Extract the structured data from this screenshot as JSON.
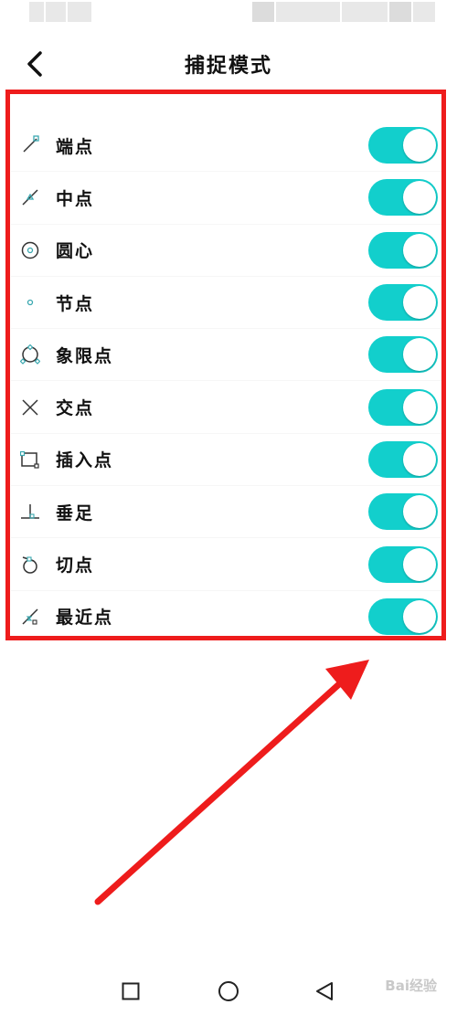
{
  "header": {
    "title": "捕捉模式"
  },
  "snap_items": [
    {
      "label": "端点",
      "icon": "endpoint-icon",
      "enabled": true
    },
    {
      "label": "中点",
      "icon": "midpoint-icon",
      "enabled": true
    },
    {
      "label": "圆心",
      "icon": "center-icon",
      "enabled": true
    },
    {
      "label": "节点",
      "icon": "node-icon",
      "enabled": true
    },
    {
      "label": "象限点",
      "icon": "quadrant-icon",
      "enabled": true
    },
    {
      "label": "交点",
      "icon": "intersection-icon",
      "enabled": true
    },
    {
      "label": "插入点",
      "icon": "insertion-icon",
      "enabled": true
    },
    {
      "label": "垂足",
      "icon": "perpendicular-icon",
      "enabled": true
    },
    {
      "label": "切点",
      "icon": "tangent-icon",
      "enabled": true
    },
    {
      "label": "最近点",
      "icon": "nearest-icon",
      "enabled": true
    }
  ],
  "colors": {
    "toggle_on": "#12cfcc",
    "annotation": "#ee1c1c",
    "icon_accent": "#3aa8b0"
  },
  "watermark": "Bai经验"
}
